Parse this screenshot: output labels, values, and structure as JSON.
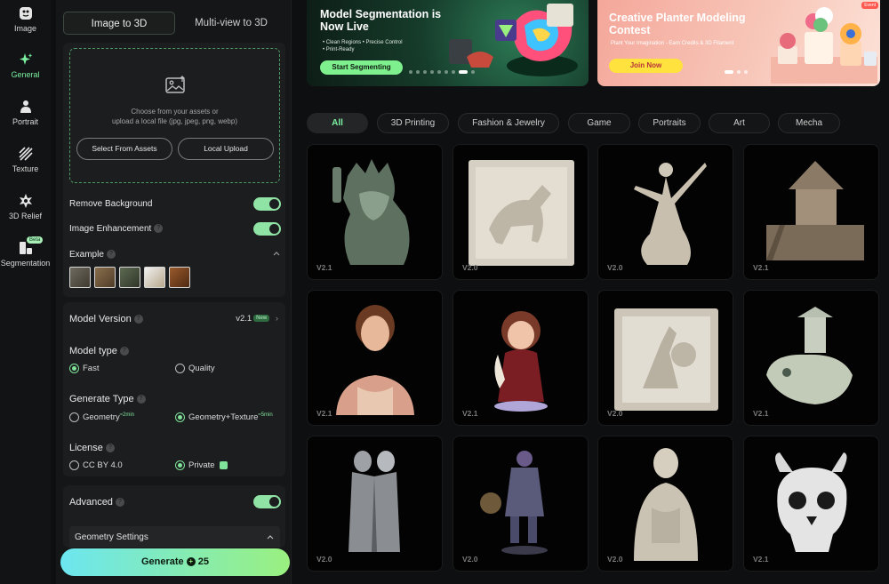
{
  "rail": {
    "items": [
      {
        "label": "Image",
        "icon": "image-rail-icon"
      },
      {
        "label": "General",
        "icon": "sparkle-icon"
      },
      {
        "label": "Portrait",
        "icon": "person-icon"
      },
      {
        "label": "Texture",
        "icon": "texture-icon"
      },
      {
        "label": "3D Relief",
        "icon": "relief-icon"
      },
      {
        "label": "Segmentation",
        "icon": "segmentation-icon",
        "badge": "Beta"
      }
    ],
    "active": "General"
  },
  "mode_tabs": {
    "image_to_3d": "Image to 3D",
    "multi_view": "Multi-view to 3D"
  },
  "upload": {
    "line1": "Choose from your assets or",
    "line2": "upload a local file (jpg, jpeg, png, webp)",
    "select_assets": "Select From Assets",
    "local_upload": "Local Upload"
  },
  "options": {
    "remove_bg": "Remove Background",
    "image_enhancement": "Image Enhancement",
    "example": "Example"
  },
  "settings": {
    "model_version_label": "Model Version",
    "model_version_value": "v2.1",
    "new_badge": "New",
    "model_type_label": "Model type",
    "fast": "Fast",
    "quality": "Quality",
    "generate_type_label": "Generate Type",
    "geometry": "Geometry",
    "geometry_time": "≈2min",
    "geometry_texture": "Geometry+Texture",
    "geometry_texture_time": "≈5min",
    "license_label": "License",
    "cc_by": "CC BY 4.0",
    "private": "Private"
  },
  "advanced": {
    "label": "Advanced",
    "geometry_settings": "Geometry Settings"
  },
  "generate": {
    "label": "Generate",
    "cost": "25"
  },
  "banners": {
    "seg_title_1": "Model Segmentation is",
    "seg_title_2": "Now Live",
    "seg_bullets_1": "• Clean Regions  • Precise Control",
    "seg_bullets_2": "• Print-Ready",
    "seg_button": "Start Segmenting",
    "planter_title_1": "Creative Planter Modeling",
    "planter_title_2": "Contest",
    "planter_sub": "Plant Your Imagination - Earn Credits & 3D Filament",
    "planter_button": "Join Now",
    "event_badge": "Event"
  },
  "categories": [
    "All",
    "3D Printing",
    "Fashion & Jewelry",
    "Game",
    "Portraits",
    "Art",
    "Mecha"
  ],
  "active_category": "All",
  "gallery": [
    {
      "version": "V2.1",
      "subject": "liberty-statue-model"
    },
    {
      "version": "V2.0",
      "subject": "horse-relief-model"
    },
    {
      "version": "V2.0",
      "subject": "dancer-statue-model"
    },
    {
      "version": "V2.1",
      "subject": "wooden-hut-model"
    },
    {
      "version": "V2.1",
      "subject": "renaissance-woman-bust-model"
    },
    {
      "version": "V2.1",
      "subject": "cartoon-woman-figure-model"
    },
    {
      "version": "V2.0",
      "subject": "warrior-relief-model"
    },
    {
      "version": "V2.1",
      "subject": "fish-pagoda-model"
    },
    {
      "version": "V2.0",
      "subject": "armored-couple-model"
    },
    {
      "version": "V2.0",
      "subject": "dark-knight-figure-model"
    },
    {
      "version": "V2.0",
      "subject": "roman-emperor-statue-model"
    },
    {
      "version": "V2.1",
      "subject": "horned-skull-model"
    }
  ],
  "colors": {
    "accent": "#7bf0a0",
    "generate_start": "#6ce6f0",
    "generate_end": "#9af07f",
    "background": "#0e0f10"
  }
}
